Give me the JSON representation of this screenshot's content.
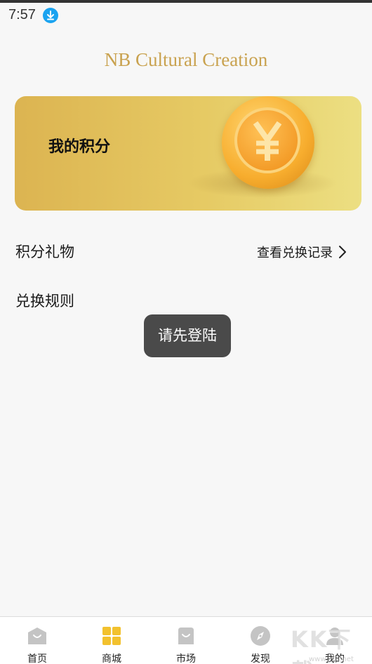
{
  "status_bar": {
    "time": "7:57"
  },
  "header": {
    "brand": "NB Cultural Creation"
  },
  "points_card": {
    "title": "我的积分"
  },
  "menu": {
    "gifts_label": "积分礼物",
    "history_label": "查看兑换记录",
    "rules_label": "兑换规则"
  },
  "toast": {
    "message": "请先登陆"
  },
  "tabs": [
    {
      "label": "首页",
      "icon": "home-bag-icon",
      "active": false
    },
    {
      "label": "商城",
      "icon": "grid-icon",
      "active": true
    },
    {
      "label": "市场",
      "icon": "shopping-bag-icon",
      "active": false
    },
    {
      "label": "发现",
      "icon": "compass-icon",
      "active": false
    },
    {
      "label": "我的",
      "icon": "profile-icon",
      "active": false
    }
  ],
  "watermark": {
    "text": "KK下载",
    "subtext": "www.kkx.net"
  },
  "colors": {
    "brand": "#c9a24f",
    "card_start": "#dcb451",
    "card_end": "#ecdf82",
    "active_tab": "#f2c12e",
    "inactive_tab": "#c4c4c4",
    "download_icon": "#1aa3f0"
  }
}
